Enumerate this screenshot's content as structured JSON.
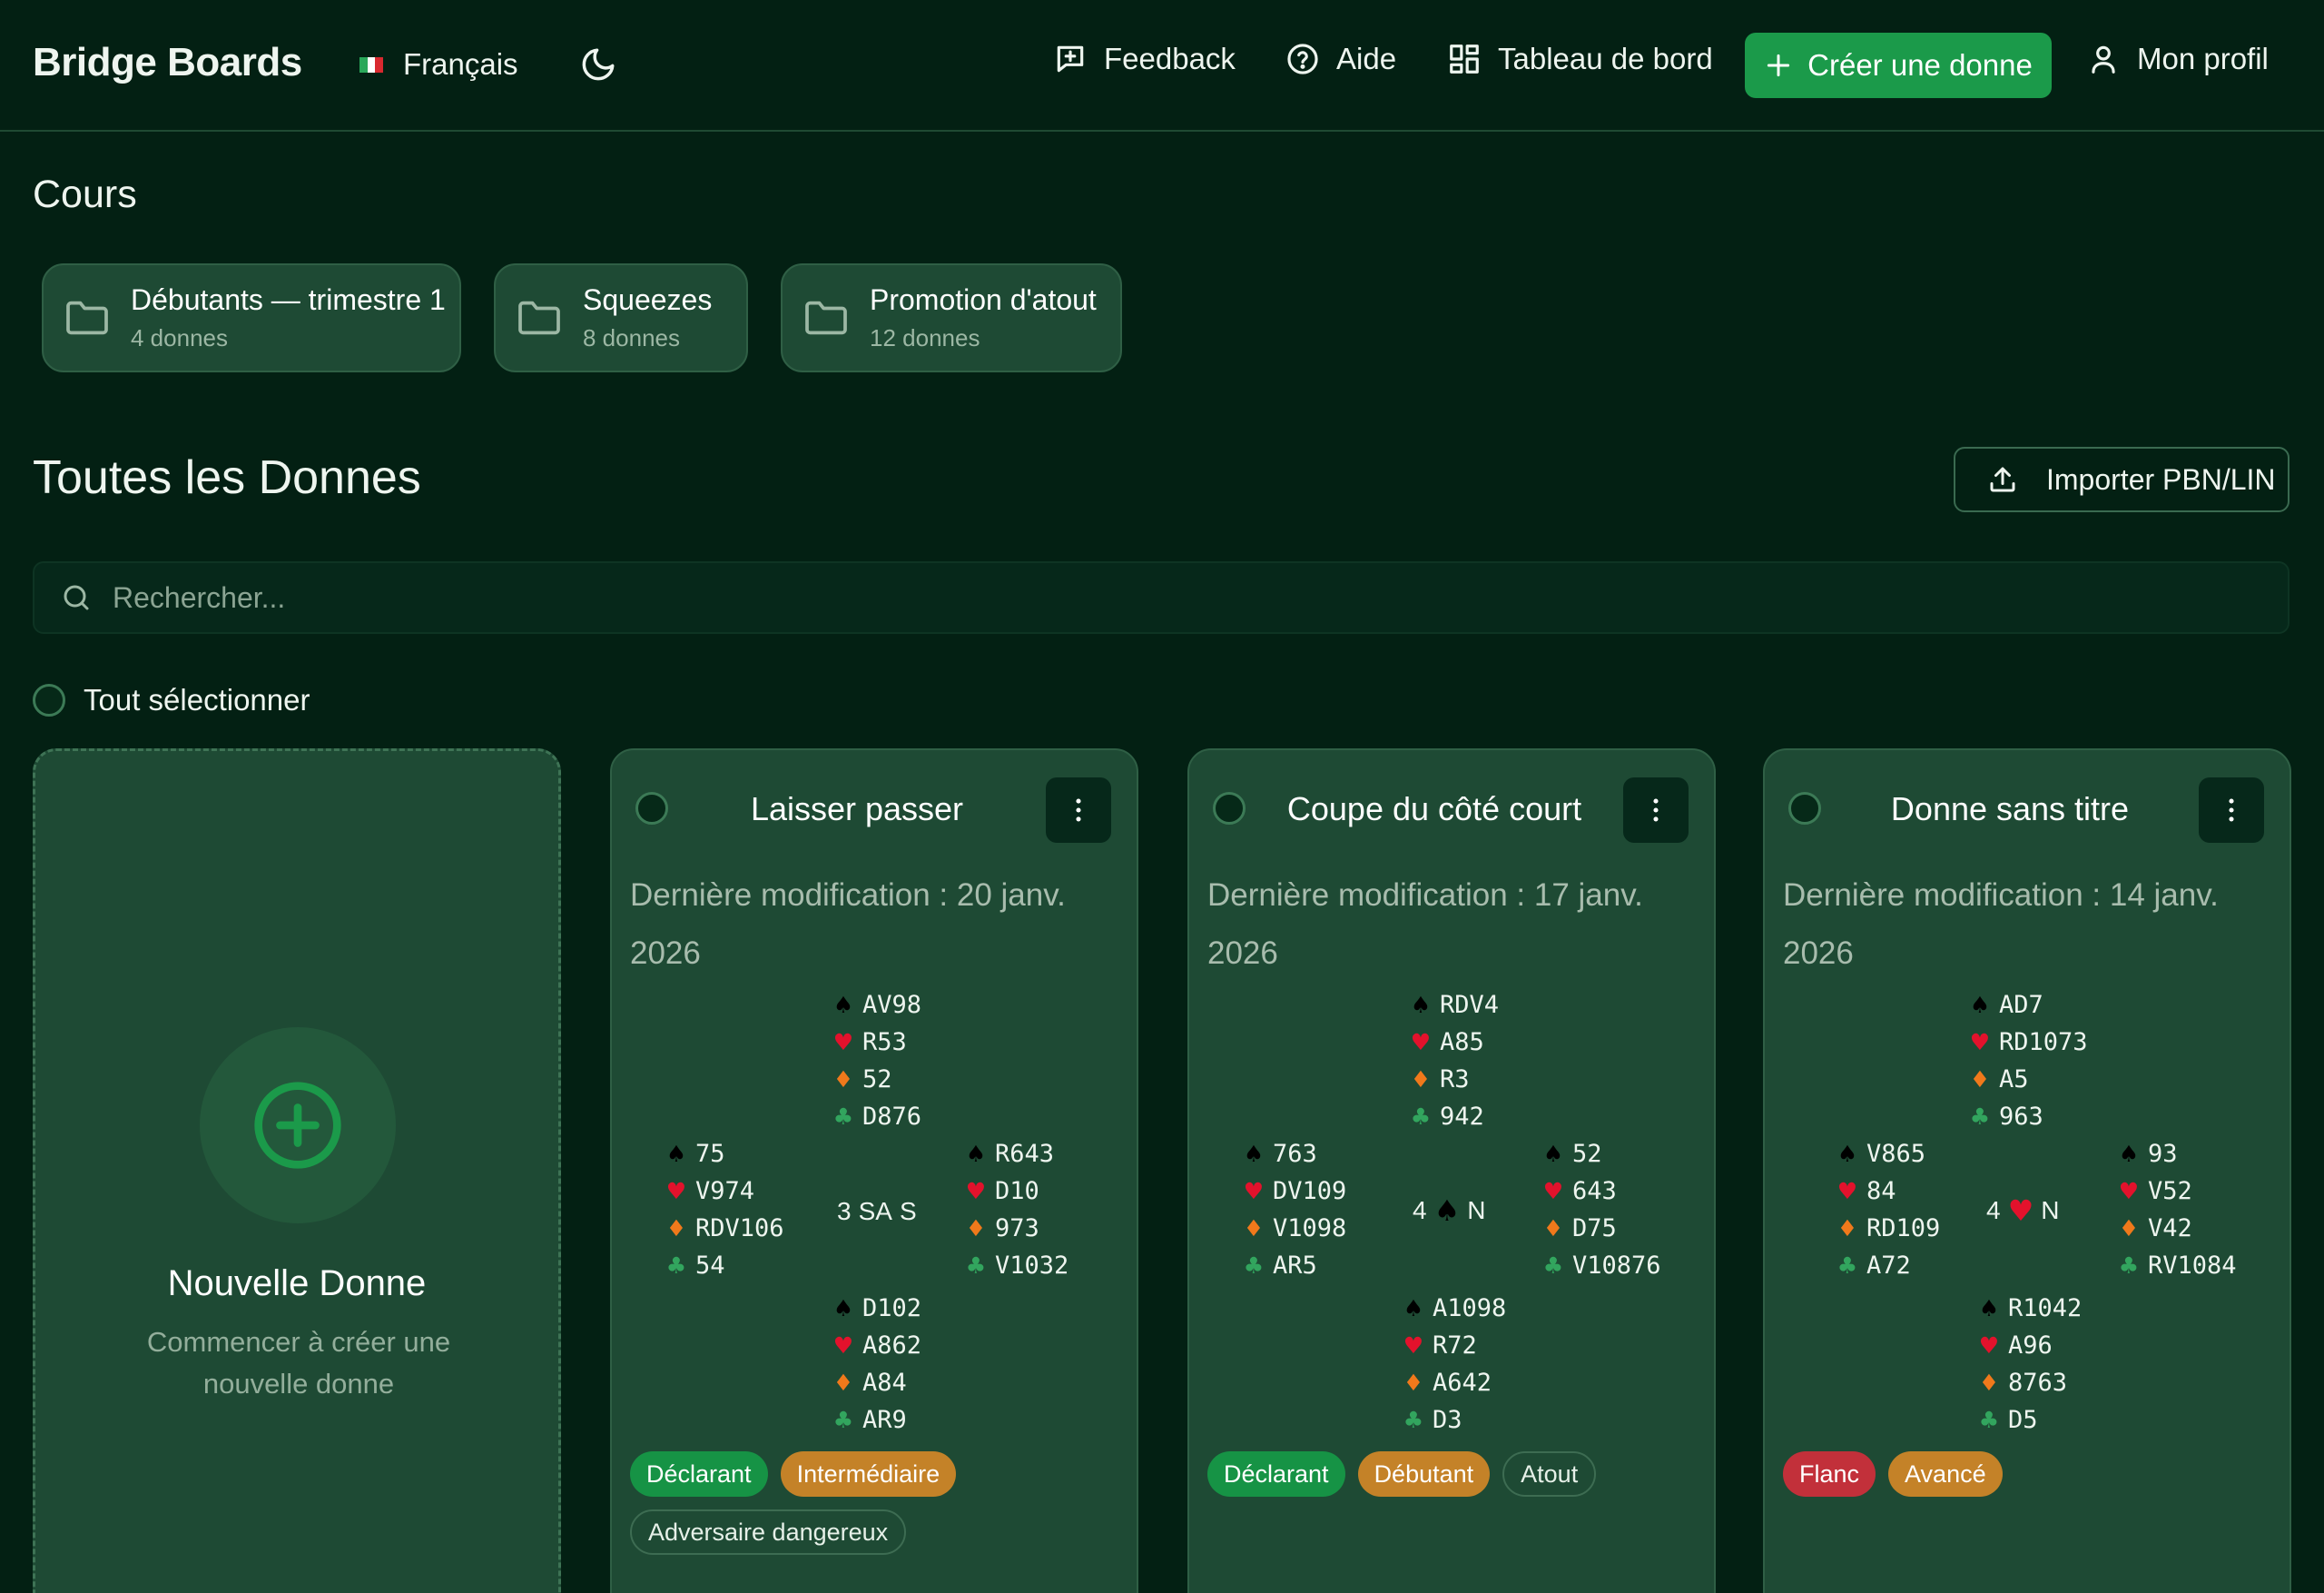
{
  "header": {
    "brand": "Bridge Boards",
    "language": "Français",
    "feedback": "Feedback",
    "help": "Aide",
    "dashboard": "Tableau de bord",
    "create": "Créer une donne",
    "profile": "Mon profil"
  },
  "courses": {
    "title": "Cours",
    "items": [
      {
        "name": "Débutants — trimestre 1",
        "count": "4 donnes"
      },
      {
        "name": "Squeezes",
        "count": "8 donnes"
      },
      {
        "name": "Promotion d'atout",
        "count": "12 donnes"
      }
    ]
  },
  "deals": {
    "title": "Toutes les Donnes",
    "import": "Importer PBN/LIN",
    "search_placeholder": "Rechercher...",
    "select_all": "Tout sélectionner",
    "new_deal": {
      "title": "Nouvelle Donne",
      "description": "Commencer à créer une nouvelle donne"
    },
    "cards": [
      {
        "title": "Laisser passer",
        "date": "Dernière modification : 20 janv. 2026",
        "contract": {
          "level": "3",
          "suit": "SA",
          "declarer": "S"
        },
        "north": [
          "AV98",
          "R53",
          "52",
          "D876"
        ],
        "west": [
          "75",
          "V974",
          "RDV106",
          "54"
        ],
        "east": [
          "R643",
          "D10",
          "973",
          "V1032"
        ],
        "south": [
          "D102",
          "A862",
          "A84",
          "AR9"
        ],
        "tags": [
          {
            "label": "Déclarant",
            "style": "green"
          },
          {
            "label": "Intermédiaire",
            "style": "orange"
          },
          {
            "label": "Adversaire dangereux",
            "style": "outline"
          }
        ]
      },
      {
        "title": "Coupe du côté court",
        "date": "Dernière modification : 17 janv. 2026",
        "contract": {
          "level": "4",
          "suit": "spade",
          "declarer": "N"
        },
        "north": [
          "RDV4",
          "A85",
          "R3",
          "942"
        ],
        "west": [
          "763",
          "DV109",
          "V1098",
          "AR5"
        ],
        "east": [
          "52",
          "643",
          "D75",
          "V10876"
        ],
        "south": [
          "A1098",
          "R72",
          "A642",
          "D3"
        ],
        "tags": [
          {
            "label": "Déclarant",
            "style": "green"
          },
          {
            "label": "Débutant",
            "style": "orange"
          },
          {
            "label": "Atout",
            "style": "outline"
          }
        ]
      },
      {
        "title": "Donne sans titre",
        "date": "Dernière modification : 14 janv. 2026",
        "contract": {
          "level": "4",
          "suit": "heart",
          "declarer": "N"
        },
        "north": [
          "AD7",
          "RD1073",
          "A5",
          "963"
        ],
        "west": [
          "V865",
          "84",
          "RD109",
          "A72"
        ],
        "east": [
          "93",
          "V52",
          "V42",
          "RV1084"
        ],
        "south": [
          "R1042",
          "A96",
          "8763",
          "D5"
        ],
        "tags": [
          {
            "label": "Flanc",
            "style": "red"
          },
          {
            "label": "Avancé",
            "style": "orange"
          }
        ]
      }
    ]
  },
  "colors": {
    "background": "#032013",
    "card": "#1e4a34",
    "accent": "#1b9a4a",
    "spade": "#000000",
    "heart": "#e3122c",
    "diamond": "#f0791b",
    "club": "#32a55e"
  },
  "icons": [
    "flag-icon",
    "moon-icon",
    "feedback-icon",
    "help-icon",
    "dashboard-icon",
    "plus-icon",
    "user-icon",
    "folder-icon",
    "upload-icon",
    "search-icon",
    "more-vertical-icon",
    "plus-circle-icon"
  ]
}
